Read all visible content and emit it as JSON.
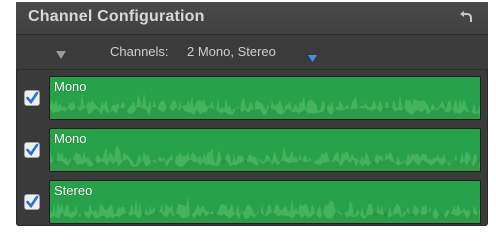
{
  "panel": {
    "title": "Channel Configuration",
    "reset_icon": "reset-arrow-icon"
  },
  "toolbar": {
    "collapse_icon": "disclosure-triangle-icon",
    "channels_label": "Channels:",
    "channels_value": "2 Mono, Stereo",
    "dropdown_icon": "chevron-down-icon"
  },
  "channels": [
    {
      "label": "Mono",
      "checked": true
    },
    {
      "label": "Mono",
      "checked": true
    },
    {
      "label": "Stereo",
      "checked": true
    }
  ],
  "colors": {
    "panel_bg": "#3a3a3a",
    "waveform": "#27a14a",
    "checkbox_check": "#2a6fd6"
  }
}
